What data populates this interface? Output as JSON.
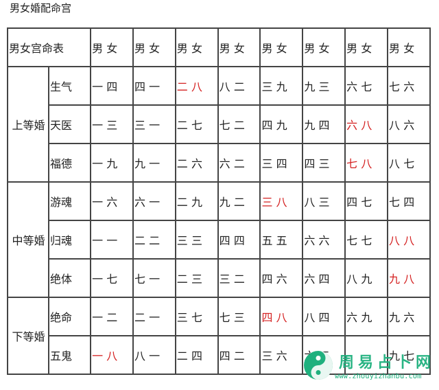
{
  "page": {
    "title": "男女婚配命宫"
  },
  "table": {
    "header": {
      "label": "男女宫命表",
      "pair_label": [
        "男",
        "女"
      ],
      "columns": 8
    },
    "groups": [
      {
        "grade": "上等婚",
        "rows": [
          {
            "name": "生气",
            "pairs": [
              {
                "m": "一",
                "f": "四",
                "highlight": false
              },
              {
                "m": "四",
                "f": "一",
                "highlight": false
              },
              {
                "m": "二",
                "f": "八",
                "highlight": true
              },
              {
                "m": "八",
                "f": "二",
                "highlight": false
              },
              {
                "m": "三",
                "f": "九",
                "highlight": false
              },
              {
                "m": "九",
                "f": "三",
                "highlight": false
              },
              {
                "m": "六",
                "f": "七",
                "highlight": false
              },
              {
                "m": "七",
                "f": "六",
                "highlight": false
              }
            ]
          },
          {
            "name": "天医",
            "pairs": [
              {
                "m": "一",
                "f": "三",
                "highlight": false
              },
              {
                "m": "三",
                "f": "一",
                "highlight": false
              },
              {
                "m": "二",
                "f": "七",
                "highlight": false
              },
              {
                "m": "七",
                "f": "二",
                "highlight": false
              },
              {
                "m": "四",
                "f": "九",
                "highlight": false
              },
              {
                "m": "九",
                "f": "四",
                "highlight": false
              },
              {
                "m": "六",
                "f": "八",
                "highlight": true
              },
              {
                "m": "八",
                "f": "六",
                "highlight": false
              }
            ]
          },
          {
            "name": "福德",
            "pairs": [
              {
                "m": "一",
                "f": "九",
                "highlight": false
              },
              {
                "m": "九",
                "f": "一",
                "highlight": false
              },
              {
                "m": "二",
                "f": "六",
                "highlight": false
              },
              {
                "m": "六",
                "f": "二",
                "highlight": false
              },
              {
                "m": "三",
                "f": "四",
                "highlight": false
              },
              {
                "m": "四",
                "f": "三",
                "highlight": false
              },
              {
                "m": "七",
                "f": "八",
                "highlight": true
              },
              {
                "m": "八",
                "f": "七",
                "highlight": false
              }
            ]
          }
        ]
      },
      {
        "grade": "中等婚",
        "rows": [
          {
            "name": "游魂",
            "pairs": [
              {
                "m": "一",
                "f": "六",
                "highlight": false
              },
              {
                "m": "六",
                "f": "一",
                "highlight": false
              },
              {
                "m": "二",
                "f": "九",
                "highlight": false
              },
              {
                "m": "九",
                "f": "二",
                "highlight": false
              },
              {
                "m": "三",
                "f": "八",
                "highlight": true
              },
              {
                "m": "八",
                "f": "三",
                "highlight": false
              },
              {
                "m": "四",
                "f": "七",
                "highlight": false
              },
              {
                "m": "七",
                "f": "四",
                "highlight": false
              }
            ]
          },
          {
            "name": "归魂",
            "pairs": [
              {
                "m": "一",
                "f": "一",
                "highlight": false
              },
              {
                "m": "二",
                "f": "二",
                "highlight": false
              },
              {
                "m": "三",
                "f": "三",
                "highlight": false
              },
              {
                "m": "四",
                "f": "四",
                "highlight": false
              },
              {
                "m": "五",
                "f": "五",
                "highlight": false
              },
              {
                "m": "六",
                "f": "六",
                "highlight": false
              },
              {
                "m": "七",
                "f": "七",
                "highlight": false
              },
              {
                "m": "八",
                "f": "八",
                "highlight": true
              }
            ]
          },
          {
            "name": "绝体",
            "pairs": [
              {
                "m": "一",
                "f": "七",
                "highlight": false
              },
              {
                "m": "七",
                "f": "一",
                "highlight": false
              },
              {
                "m": "二",
                "f": "三",
                "highlight": false
              },
              {
                "m": "三",
                "f": "二",
                "highlight": false
              },
              {
                "m": "四",
                "f": "六",
                "highlight": false
              },
              {
                "m": "六",
                "f": "四",
                "highlight": false
              },
              {
                "m": "八",
                "f": "九",
                "highlight": false
              },
              {
                "m": "九",
                "f": "八",
                "highlight": true
              }
            ]
          }
        ]
      },
      {
        "grade": "下等婚",
        "rows": [
          {
            "name": "绝命",
            "pairs": [
              {
                "m": "一",
                "f": "二",
                "highlight": false
              },
              {
                "m": "二",
                "f": "一",
                "highlight": false
              },
              {
                "m": "三",
                "f": "七",
                "highlight": false
              },
              {
                "m": "七",
                "f": "三",
                "highlight": false
              },
              {
                "m": "四",
                "f": "八",
                "highlight": true
              },
              {
                "m": "八",
                "f": "四",
                "highlight": false
              },
              {
                "m": "六",
                "f": "九",
                "highlight": false
              },
              {
                "m": "九",
                "f": "六",
                "highlight": false
              }
            ]
          },
          {
            "name": "五鬼",
            "pairs": [
              {
                "m": "一",
                "f": "八",
                "highlight": true
              },
              {
                "m": "八",
                "f": "一",
                "highlight": false
              },
              {
                "m": "二",
                "f": "四",
                "highlight": false
              },
              {
                "m": "四",
                "f": "二",
                "highlight": false
              },
              {
                "m": "三",
                "f": "六",
                "highlight": false
              },
              {
                "m": "六",
                "f": "三",
                "highlight": false
              },
              {
                "m": "",
                "f": "",
                "highlight": false
              },
              {
                "m": "九",
                "f": "七",
                "highlight": false
              }
            ]
          }
        ]
      }
    ]
  },
  "colors": {
    "highlight": "#d42020",
    "border": "#444444",
    "watermark": "#1fb07e"
  },
  "watermark": {
    "icon": "taiji-logo-icon",
    "name": "周易占卜网",
    "url": "www.zhouyizhanbu.com"
  }
}
